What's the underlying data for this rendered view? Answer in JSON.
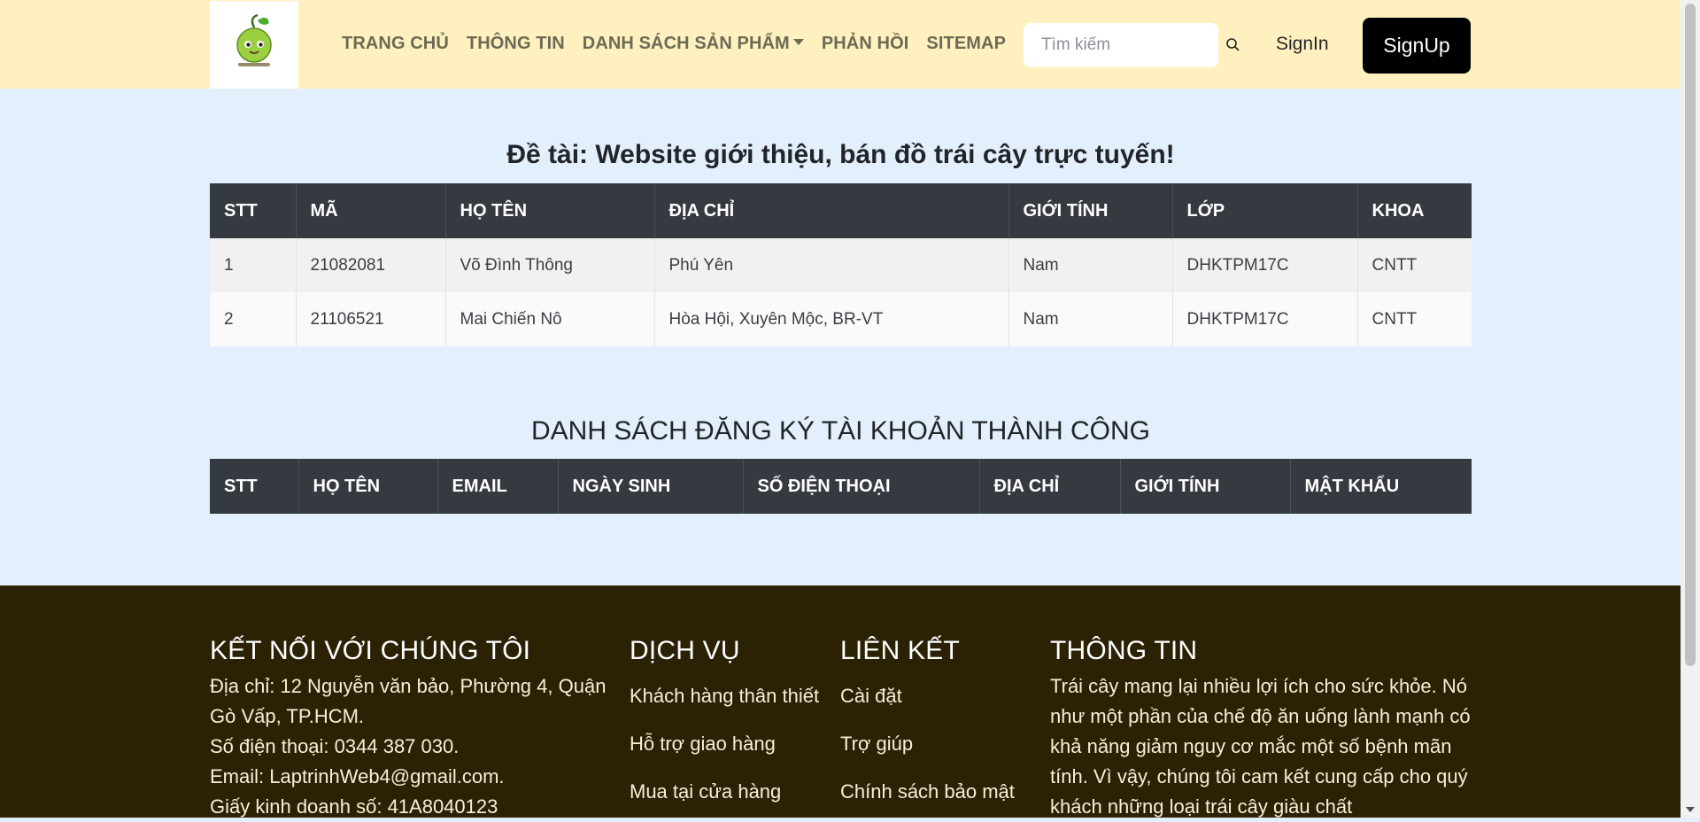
{
  "navbar": {
    "items": [
      "TRANG CHỦ",
      "THÔNG TIN",
      "DANH SÁCH SẢN PHẨM",
      "PHẢN HỒI",
      "SITEMAP"
    ],
    "search_placeholder": "Tìm kiếm",
    "signin_label": "SignIn",
    "signup_label": "SignUp"
  },
  "project": {
    "title": "Đề tài: Website giới thiệu, bán đồ trái cây trực tuyến!",
    "headers": [
      "STT",
      "MÃ",
      "HỌ TÊN",
      "ĐỊA CHỈ",
      "GIỚI TÍNH",
      "LỚP",
      "KHOA"
    ],
    "rows": [
      [
        "1",
        "21082081",
        "Võ Đình Thông",
        "Phú Yên",
        "Nam",
        "DHKTPM17C",
        "CNTT"
      ],
      [
        "2",
        "21106521",
        "Mai Chiến Nô",
        "Hòa Hội, Xuyên Mộc, BR-VT",
        "Nam",
        "DHKTPM17C",
        "CNTT"
      ]
    ]
  },
  "accounts": {
    "title": "DANH SÁCH ĐĂNG KÝ TÀI KHOẢN THÀNH CÔNG",
    "headers": [
      "STT",
      "HỌ TÊN",
      "EMAIL",
      "NGÀY SINH",
      "SỐ ĐIỆN THOẠI",
      "ĐỊA CHỈ",
      "GIỚI TÍNH",
      "MẬT KHẨU"
    ]
  },
  "footer": {
    "connect": {
      "title": "KẾT NỐI VỚI CHÚNG TÔI",
      "address": "Địa chỉ: 12 Nguyễn văn bảo, Phường 4, Quận Gò Vấp, TP.HCM.",
      "phone": "Số điện thoại: 0344 387 030.",
      "email": "Email: LaptrinhWeb4@gmail.com.",
      "license": "Giấy kinh doanh số: 41A8040123"
    },
    "services": {
      "title": "DỊCH VỤ",
      "links": [
        "Khách hàng thân thiết",
        "Hỗ trợ giao hàng",
        "Mua tại cửa hàng"
      ]
    },
    "links": {
      "title": "LIÊN KẾT",
      "links": [
        "Cài đặt",
        "Trợ giúp",
        "Chính sách bảo mật"
      ]
    },
    "info": {
      "title": "THÔNG TIN",
      "text": "Trái cây mang lại nhiều lợi ích cho sức khỏe. Nó như một phần của chế độ ăn uống lành mạnh có khả năng giảm nguy cơ mắc một số bệnh mãn tính. Vì vậy, chúng tôi cam kết cung cấp cho quý khách những loại trái cây giàu chất"
    }
  },
  "colors": {
    "navbar_bg": "#fff1bf",
    "page_bg": "#e4effd",
    "table_header_bg": "#343a40",
    "footer_bg": "#2b2105",
    "signup_bg": "#000000"
  }
}
